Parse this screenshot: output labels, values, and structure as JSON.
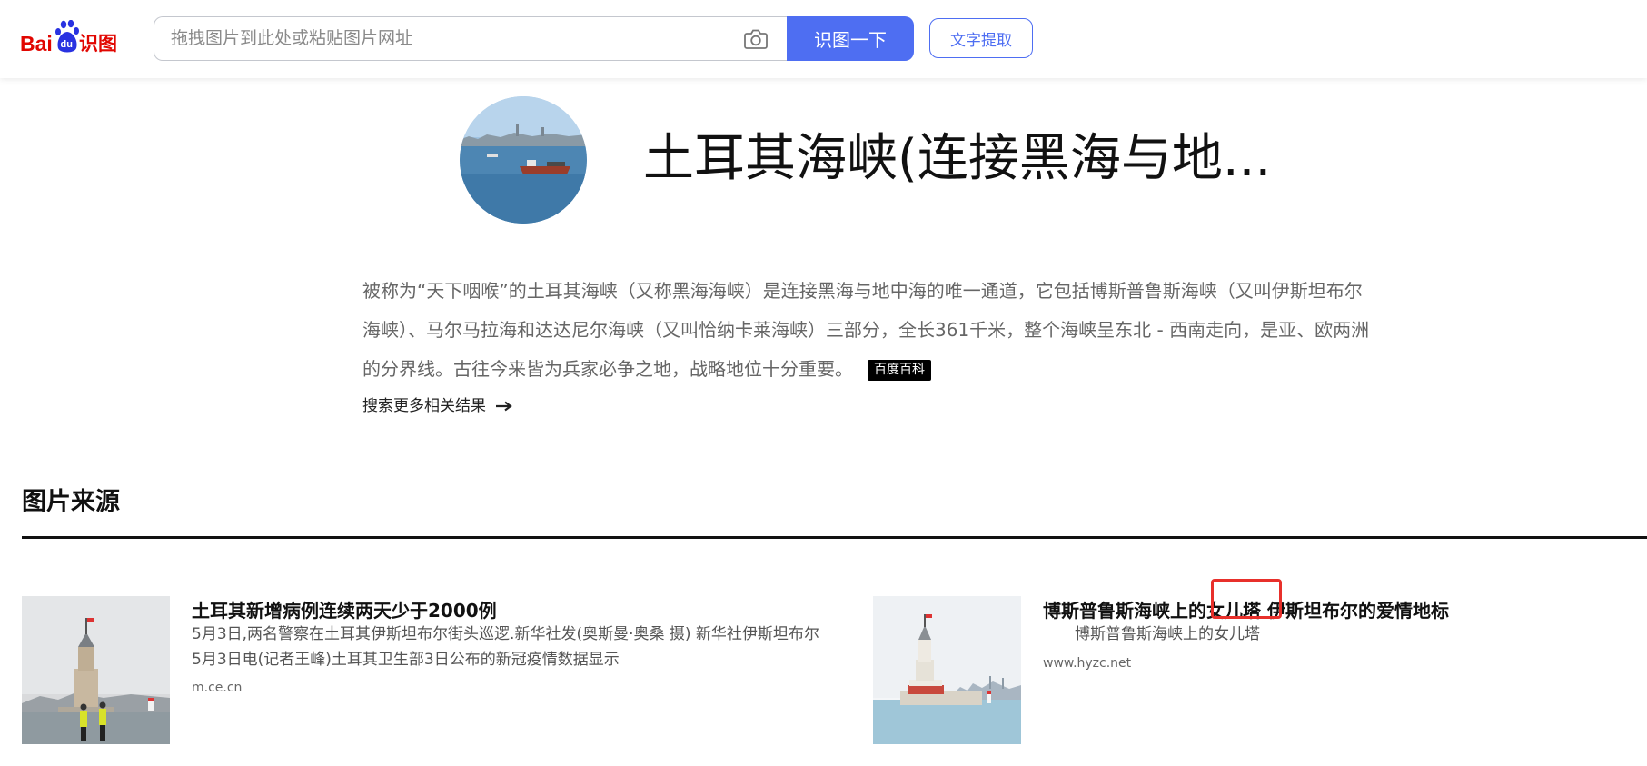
{
  "header": {
    "logo": {
      "prefix": "Bai",
      "paw": "du",
      "suffix": "识图"
    },
    "search": {
      "placeholder": "拖拽图片到此处或粘贴图片网址",
      "value": ""
    },
    "search_button_label": "识图一下",
    "text_extract_label": "文字提取",
    "brand_color": "#4e6ef2"
  },
  "baike": {
    "title": "土耳其海峡(连接黑海与地...",
    "description": "被称为“天下咽喉”的土耳其海峡（又称黑海海峡）是连接黑海与地中海的唯一通道，它包括博斯普鲁斯海峡（又叫伊斯坦布尔海峡）、马尔马拉海和达达尼尔海峡（又叫恰纳卡莱海峡）三部分，全长361千米，整个海峡呈东北 - 西南走向，是亚、欧两洲的分界线。古往今来皆为兵家必争之地，战略地位十分重要。",
    "source_badge": "百度百科",
    "more_link": "搜索更多相关结果",
    "image_icon": "strait-photo"
  },
  "sources": {
    "section_title": "图片来源",
    "results": [
      {
        "title": "土耳其新增病例连续两天少于2000例",
        "snippet": "5月3日,两名警察在土耳其伊斯坦布尔街头巡逻.新华社发(奥斯曼·奥桑 摄) 新华社伊斯坦布尔5月3日电(记者王峰)土耳其卫生部3日公布的新冠疫情数据显示",
        "url": "m.ce.cn",
        "image_icon": "maiden-tower-with-police-photo"
      },
      {
        "title": "博斯普鲁斯海峡上的女儿塔 伊斯坦布尔的爱情地标",
        "snippet": "博斯普鲁斯海峡上的女儿塔",
        "url": "www.hyzc.net",
        "image_icon": "maiden-tower-photo",
        "highlight_color": "#e8302b"
      }
    ]
  }
}
